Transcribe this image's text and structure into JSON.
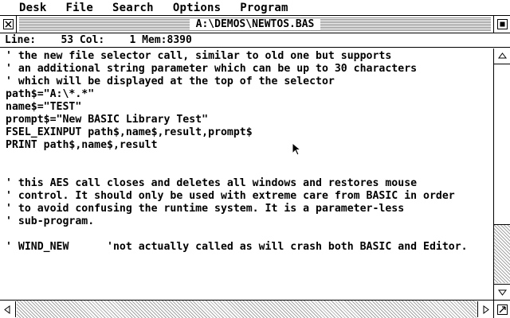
{
  "menu": [
    "Desk",
    "File",
    "Search",
    "Options",
    "Program"
  ],
  "window": {
    "title": "A:\\DEMOS\\NEWTOS.BAS",
    "info": "Line:    53 Col:    1 Mem:8390"
  },
  "code_lines": [
    "' the new file selector call, similar to old one but supports",
    "' an additional string parameter which can be up to 30 characters",
    "' which will be displayed at the top of the selector",
    "path$=\"A:\\*.*\"",
    "name$=\"TEST\"",
    "prompt$=\"New BASIC Library Test\"",
    "FSEL_EXINPUT path$,name$,result,prompt$",
    "PRINT path$,name$,result",
    "",
    "",
    "' this AES call closes and deletes all windows and restores mouse",
    "' control. It should only be used with extreme care from BASIC in order",
    "' to avoid confusing the runtime system. It is a parameter-less",
    "' sub-program.",
    "",
    "' WIND_NEW      'not actually called as will crash both BASIC and Editor."
  ],
  "icons": {
    "closer": "close-box-icon",
    "fuller": "full-box-icon",
    "up": "arrow-up-icon",
    "down": "arrow-down-icon",
    "left": "arrow-left-icon",
    "right": "arrow-right-icon",
    "sizer": "size-box-icon",
    "cursor": "mouse-pointer-icon"
  }
}
